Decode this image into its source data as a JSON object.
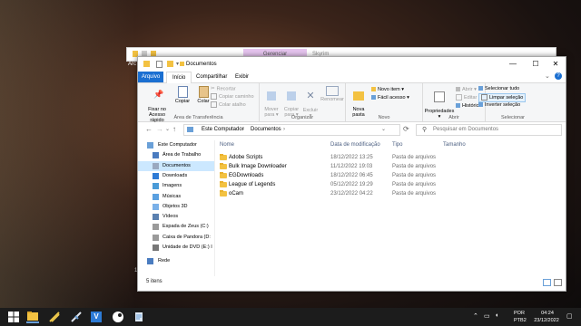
{
  "back_window": {
    "context_tab": "Gerenciar",
    "name": "Skyrim"
  },
  "window": {
    "title": "Documentos",
    "controls": {
      "minimize": "—",
      "maximize": "☐",
      "close": "✕"
    }
  },
  "tabs": {
    "file": "Arquivo",
    "home": "Início",
    "share": "Compartilhar",
    "view": "Exibir"
  },
  "ribbon": {
    "clipboard": {
      "label": "Área de Transferência",
      "pin": "Fixar no\nAcesso rápido",
      "copy": "Copiar",
      "paste": "Colar",
      "cut": "Recortar",
      "copy_path": "Copiar caminho",
      "paste_shortcut": "Colar atalho"
    },
    "organize": {
      "label": "Organizar",
      "move_to": "Mover\npara ▾",
      "copy_to": "Copiar\npara ▾",
      "delete": "Excluir\n▾",
      "rename": "Renomear"
    },
    "new": {
      "label": "Novo",
      "new_folder": "Nova\npasta",
      "new_item": "Novo item ▾",
      "easy_access": "Fácil acesso ▾"
    },
    "open": {
      "label": "Abrir",
      "properties": "Propriedades\n▾",
      "open": "Abrir ▾",
      "edit": "Editar",
      "history": "Histórico"
    },
    "select": {
      "label": "Selecionar",
      "select_all": "Selecionar tudo",
      "select_none": "Limpar seleção",
      "invert": "Inverter seleção"
    }
  },
  "address": {
    "back": "←",
    "forward": "→",
    "recent": "⌄",
    "up": "↑",
    "crumbs": [
      "Este Computador",
      "Documentos"
    ],
    "refresh": "⟳",
    "search_placeholder": "Pesquisar em Documentos"
  },
  "nav": [
    {
      "label": "Este Computador",
      "icon": "computer-icon",
      "level": 0
    },
    {
      "label": "Área de Trabalho",
      "icon": "desktop-icon",
      "level": 1
    },
    {
      "label": "Documentos",
      "icon": "documents-icon",
      "level": 1,
      "selected": true
    },
    {
      "label": "Downloads",
      "icon": "downloads-icon",
      "level": 1
    },
    {
      "label": "Imagens",
      "icon": "pictures-icon",
      "level": 1
    },
    {
      "label": "Músicas",
      "icon": "music-icon",
      "level": 1
    },
    {
      "label": "Objetos 3D",
      "icon": "objects3d-icon",
      "level": 1
    },
    {
      "label": "Vídeos",
      "icon": "videos-icon",
      "level": 1
    },
    {
      "label": "Espada de Zeus (C:)",
      "icon": "drive-icon",
      "level": 1
    },
    {
      "label": "Caixa de Pandora (D:",
      "icon": "drive-icon",
      "level": 1
    },
    {
      "label": "Unidade de DVD (E:) I",
      "icon": "dvd-icon",
      "level": 1
    },
    {
      "label": "Rede",
      "icon": "network-icon",
      "level": 0
    }
  ],
  "columns": {
    "name": "Nome",
    "modified": "Data de modificação",
    "type": "Tipo",
    "size": "Tamanho"
  },
  "files": [
    {
      "name": "Adobe Scripts",
      "date": "18/12/2022 13:25",
      "type": "Pasta de arquivos"
    },
    {
      "name": "Bulk Image Downloader",
      "date": "11/12/2022 19:03",
      "type": "Pasta de arquivos"
    },
    {
      "name": "EGDownloads",
      "date": "18/12/2022 06:45",
      "type": "Pasta de arquivos"
    },
    {
      "name": "League of Legends",
      "date": "05/12/2022 19:29",
      "type": "Pasta de arquivos"
    },
    {
      "name": "oCam",
      "date": "23/12/2022 04:22",
      "type": "Pasta de arquivos"
    }
  ],
  "status": "5 itens",
  "edge_text": {
    "left_tab": "Arc",
    "left_num": "17"
  },
  "taskbar": {
    "lang": "POR",
    "layout": "PTB2",
    "time": "04:24",
    "date": "23/12/2022",
    "apps": [
      "start-icon",
      "file-explorer-icon",
      "game-icon",
      "visual-studio-icon",
      "terminal-icon",
      "steam-icon",
      "notepad-icon"
    ]
  },
  "colors": {
    "accent": "#1a6fd1",
    "folder": "#f3c242",
    "selected": "#cce8ff",
    "taskbar": "#1c1c1c"
  }
}
